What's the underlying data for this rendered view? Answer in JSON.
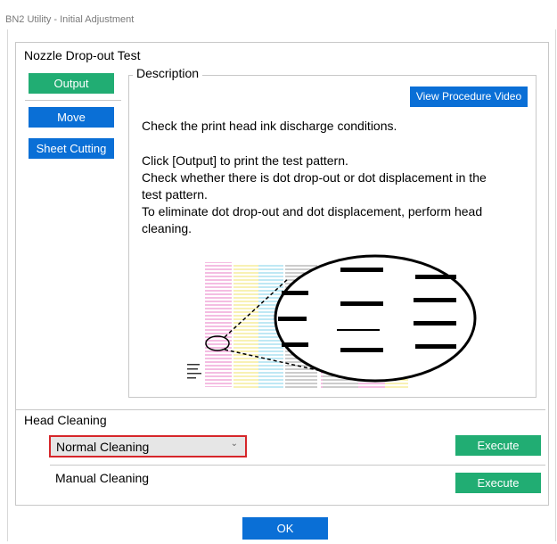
{
  "window": {
    "title": "BN2 Utility - Initial Adjustment"
  },
  "nozzle_test": {
    "title": "Nozzle Drop-out Test",
    "buttons": {
      "output": "Output",
      "move": "Move",
      "sheet_cutting": "Sheet Cutting"
    },
    "description": {
      "legend": "Description",
      "video_button": "View Procedure Video",
      "line1": "Check the print head ink discharge conditions.",
      "line2": "Click [Output] to print the test pattern.",
      "line3": "Check whether there is dot drop-out or dot displacement in the",
      "line4": "test pattern.",
      "line5": "To eliminate dot drop-out and dot displacement, perform head",
      "line6": "cleaning."
    }
  },
  "head_cleaning": {
    "title": "Head Cleaning",
    "normal_select_value": "Normal Cleaning",
    "execute_label": "Execute",
    "manual_label": "Manual Cleaning"
  },
  "footer": {
    "ok_label": "OK"
  },
  "colors": {
    "green": "#21ad73",
    "blue": "#0a6fd6",
    "highlight": "#d6262a"
  }
}
